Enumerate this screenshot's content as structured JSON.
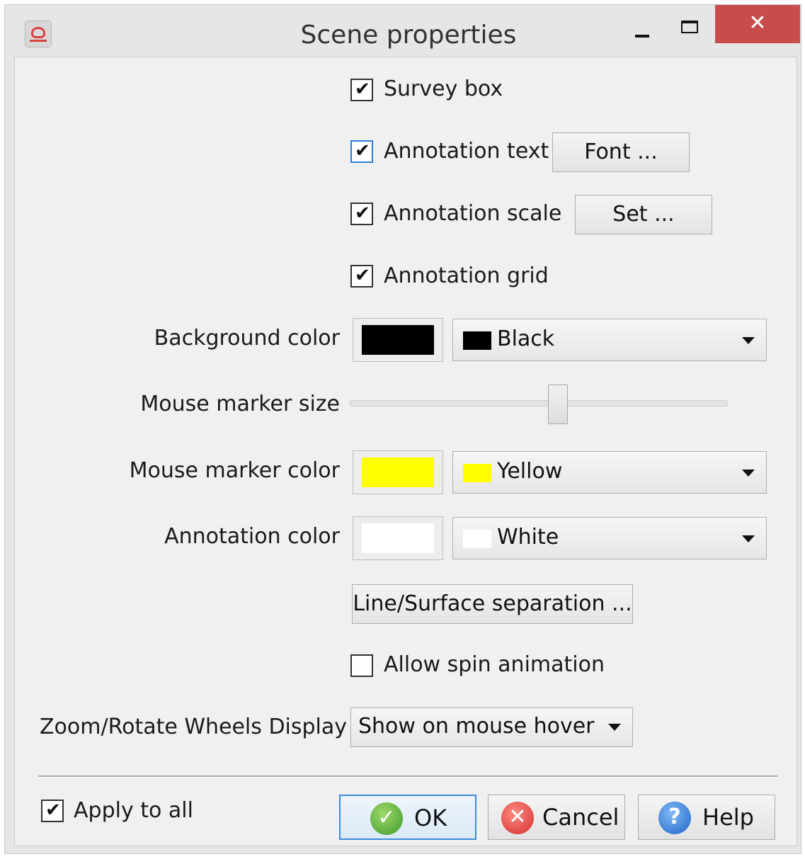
{
  "window": {
    "title": "Scene properties",
    "close_glyph": "✕"
  },
  "options": {
    "survey_box": {
      "label": "Survey box",
      "checked": true
    },
    "annotation_text": {
      "label": "Annotation text",
      "checked": true,
      "button": "Font ..."
    },
    "annotation_scale": {
      "label": "Annotation scale",
      "checked": true,
      "button": "Set ..."
    },
    "annotation_grid": {
      "label": "Annotation grid",
      "checked": true
    }
  },
  "background_color": {
    "label": "Background color",
    "value": "Black",
    "hex": "#000000"
  },
  "mouse_marker_size": {
    "label": "Mouse marker size",
    "level": 0.55
  },
  "mouse_marker_color": {
    "label": "Mouse marker color",
    "value": "Yellow",
    "hex": "#ffff00"
  },
  "annotation_color": {
    "label": "Annotation color",
    "value": "White",
    "hex": "#ffffff"
  },
  "line_surface_button": "Line/Surface separation ...",
  "spin_animation": {
    "label": "Allow spin animation",
    "checked": false
  },
  "wheels_display": {
    "label": "Zoom/Rotate Wheels Display",
    "value": "Show on mouse hover"
  },
  "footer": {
    "apply_to_all": {
      "label": "Apply to all",
      "checked": true
    },
    "ok": "OK",
    "cancel": "Cancel",
    "help": "Help"
  },
  "check_glyph": "✔"
}
